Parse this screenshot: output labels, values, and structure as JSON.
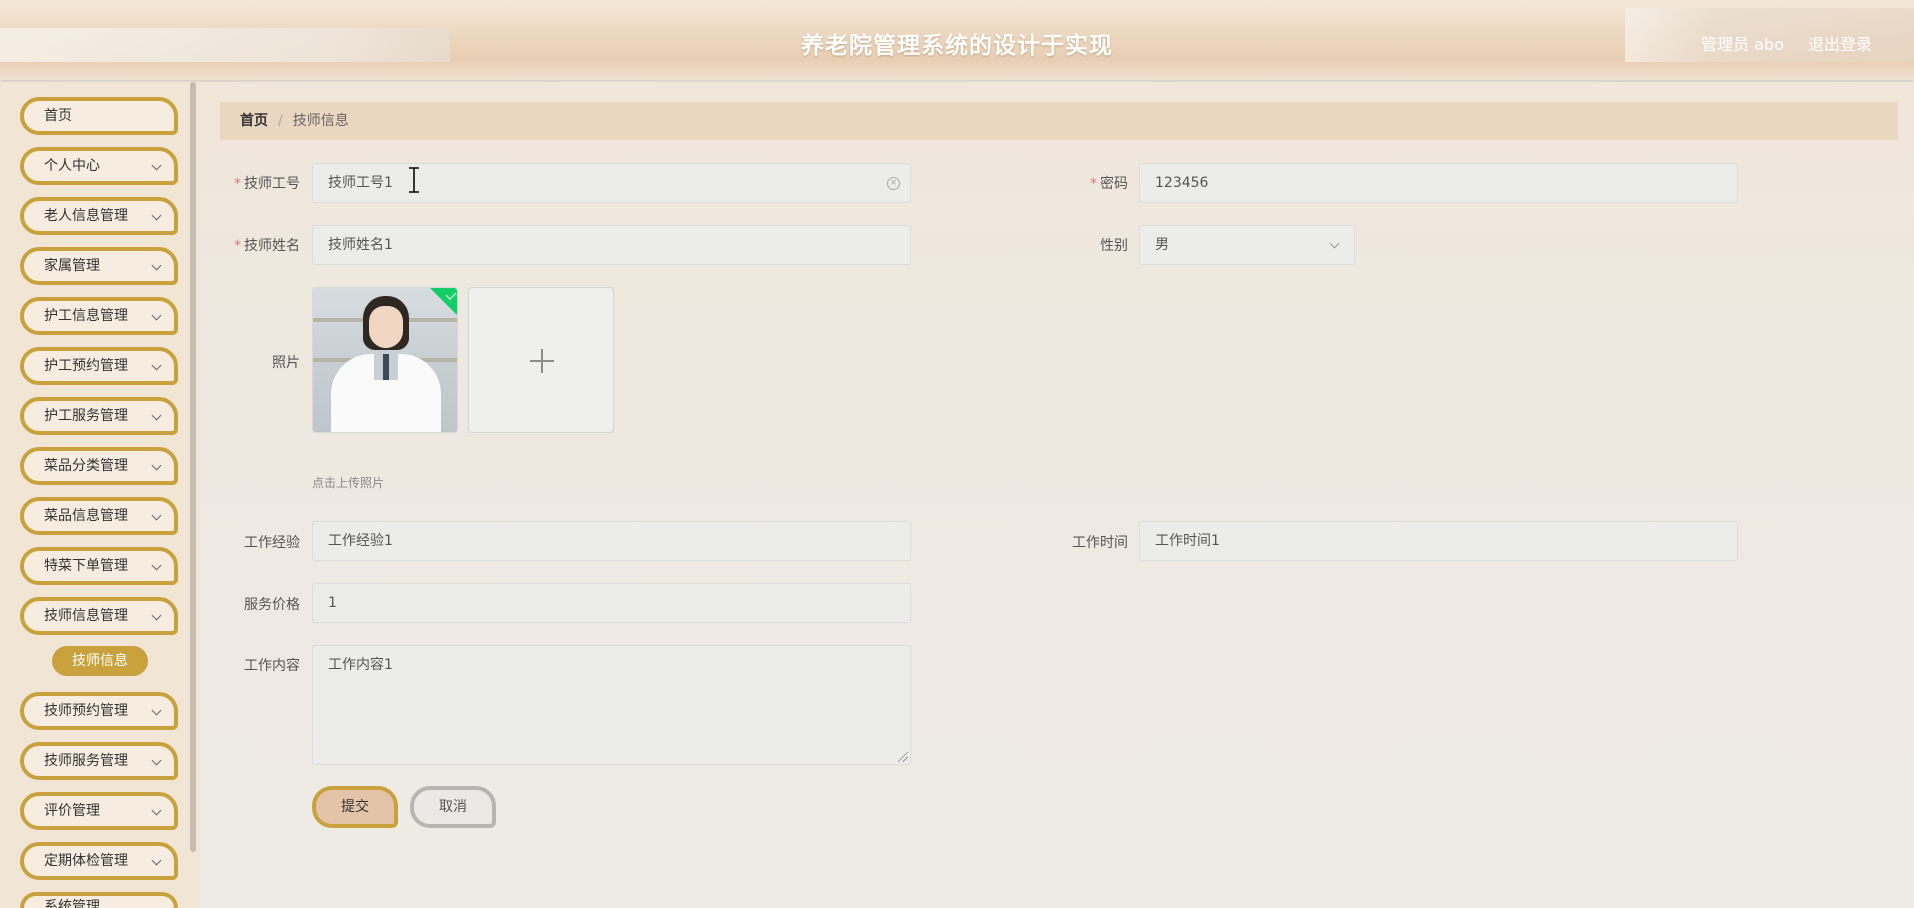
{
  "header": {
    "title": "养老院管理系统的设计于实现",
    "user": "管理员 abo",
    "logout": "退出登录"
  },
  "sidebar": {
    "items": [
      {
        "label": "首页"
      },
      {
        "label": "个人中心"
      },
      {
        "label": "老人信息管理"
      },
      {
        "label": "家属管理"
      },
      {
        "label": "护工信息管理"
      },
      {
        "label": "护工预约管理"
      },
      {
        "label": "护工服务管理"
      },
      {
        "label": "菜品分类管理"
      },
      {
        "label": "菜品信息管理"
      },
      {
        "label": "特菜下单管理"
      },
      {
        "label": "技师信息管理"
      },
      {
        "label": "技师预约管理"
      },
      {
        "label": "技师服务管理"
      },
      {
        "label": "评价管理"
      },
      {
        "label": "定期体检管理"
      },
      {
        "label": "系统管理"
      }
    ],
    "active_sub": "技师信息"
  },
  "breadcrumb": {
    "home": "首页",
    "sep": "/",
    "current": "技师信息"
  },
  "form": {
    "tech_no_label": "技师工号",
    "tech_no_value": "技师工号1",
    "password_label": "密码",
    "password_value": "123456",
    "tech_name_label": "技师姓名",
    "tech_name_value": "技师姓名1",
    "gender_label": "性别",
    "gender_value": "男",
    "photo_label": "照片",
    "photo_hint": "点击上传照片",
    "experience_label": "工作经验",
    "experience_value": "工作经验1",
    "work_time_label": "工作时间",
    "work_time_value": "工作时间1",
    "price_label": "服务价格",
    "price_value": "1",
    "content_label": "工作内容",
    "content_value": "工作内容1",
    "required_mark": "*",
    "submit": "提交",
    "cancel": "取消"
  }
}
